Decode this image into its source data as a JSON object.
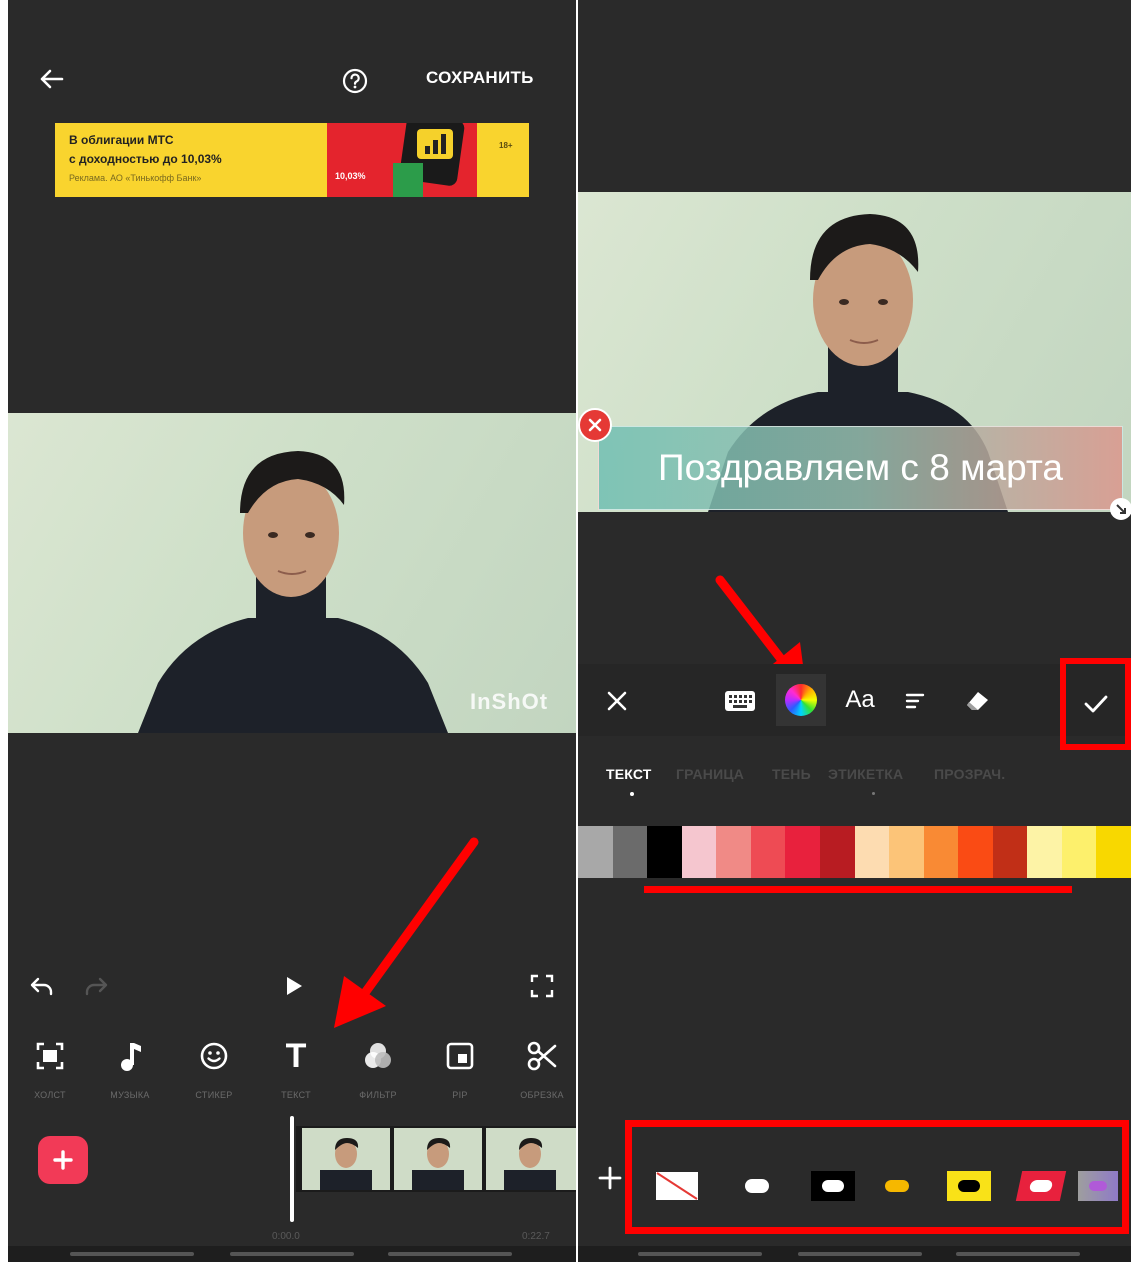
{
  "left": {
    "header": {
      "save_label": "СОХРАНИТЬ"
    },
    "ad": {
      "line1": "В облигации МТС",
      "line2": "с доходностью до 10,03%",
      "line3": "Реклама. АО «Тинькофф Банк»",
      "badge": "18+",
      "rate": "10,03%"
    },
    "watermark": "InShOt",
    "tools": [
      {
        "label": "ХОЛСТ"
      },
      {
        "label": "МУЗЫКА"
      },
      {
        "label": "СТИКЕР"
      },
      {
        "label": "ТЕКСТ",
        "glyph": "T"
      },
      {
        "label": "ФИЛЬТР"
      },
      {
        "label": "PIP"
      },
      {
        "label": "ОБРЕЗКА"
      }
    ],
    "timeline": {
      "start_time": "0:00.0",
      "end_time": "0:22.7"
    }
  },
  "right": {
    "caption_text": "Поздравляем с 8 марта",
    "toolbar": {
      "font_label": "Aa"
    },
    "tabs": [
      "ТЕКСТ",
      "ГРАНИЦА",
      "ТЕНЬ",
      "ЭТИКЕТКА",
      "ПРОЗРАЧ."
    ],
    "palette": [
      "#a8a8a8",
      "#6b6b6b",
      "#000000",
      "#f5c6cf",
      "#f08a86",
      "#ee4b54",
      "#e8213d",
      "#b81c22",
      "#fddcb1",
      "#fcc478",
      "#f98a34",
      "#fa4b14",
      "#c12f17",
      "#fdf3a6",
      "#fdf06c",
      "#f8d800"
    ]
  },
  "colors": {
    "accent_red": "#ff0000",
    "add_button": "#f23a57",
    "background": "#2a2a2a"
  }
}
